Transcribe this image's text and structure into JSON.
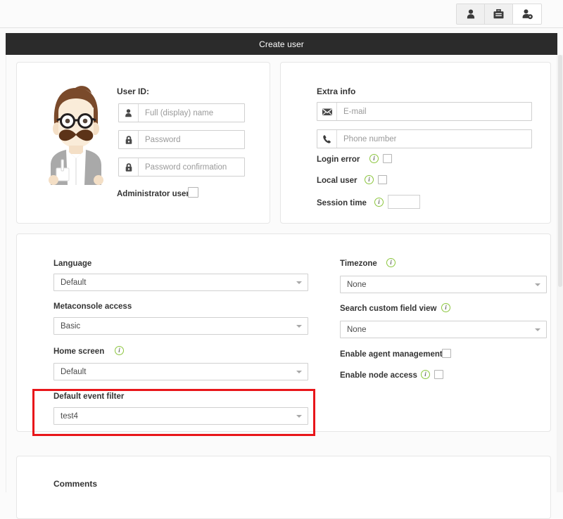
{
  "window": {
    "title": "Create user",
    "accent_red": "#e8161a",
    "accent_green": "#8cc63e",
    "titlebar_bg": "#2b2b2b"
  },
  "topbar": {
    "tabs": [
      {
        "icon": "user-icon",
        "label": "User",
        "active": false
      },
      {
        "icon": "briefcase-icon",
        "label": "Profile",
        "active": false
      },
      {
        "icon": "user-settings-icon",
        "label": "User management",
        "active": true
      }
    ]
  },
  "user_id_card": {
    "title": "User ID:",
    "avatar": "hipster-avatar-image",
    "fields": [
      {
        "icon": "user-icon",
        "placeholder": "Full (display) name",
        "value": ""
      },
      {
        "icon": "lock-icon",
        "placeholder": "Password",
        "value": ""
      },
      {
        "icon": "lock-icon",
        "placeholder": "Password confirmation",
        "value": ""
      }
    ],
    "administrator": {
      "label": "Administrator user",
      "checked": false
    }
  },
  "extra_info_card": {
    "title": "Extra info",
    "fields": [
      {
        "icon": "envelope-icon",
        "placeholder": "E-mail",
        "value": ""
      },
      {
        "icon": "phone-icon",
        "placeholder": "Phone number",
        "value": ""
      }
    ],
    "login_error": {
      "label": "Login error",
      "info": "info-icon",
      "checked": false
    },
    "local_user": {
      "label": "Local user",
      "info": "info-icon",
      "checked": false
    },
    "session_time": {
      "label": "Session time",
      "info": "info-icon",
      "value": ""
    }
  },
  "config_card": {
    "left": [
      {
        "label": "Language",
        "value": "Default",
        "info": false
      },
      {
        "label": "Metaconsole access",
        "value": "Basic",
        "info": false
      },
      {
        "label": "Home screen",
        "value": "Default",
        "info": true
      },
      {
        "label": "Default event filter",
        "value": "test4",
        "info": false,
        "highlighted": true
      }
    ],
    "right": {
      "timezone": {
        "label": "Timezone",
        "value": "None",
        "info": true
      },
      "search_custom_field_view": {
        "label": "Search custom field view",
        "value": "None",
        "info": true
      },
      "enable_agent_management": {
        "label": "Enable agent management",
        "info": false,
        "checked": false
      },
      "enable_node_access": {
        "label": "Enable node access",
        "info": true,
        "checked": false
      }
    }
  },
  "comments_card": {
    "title": "Comments"
  }
}
